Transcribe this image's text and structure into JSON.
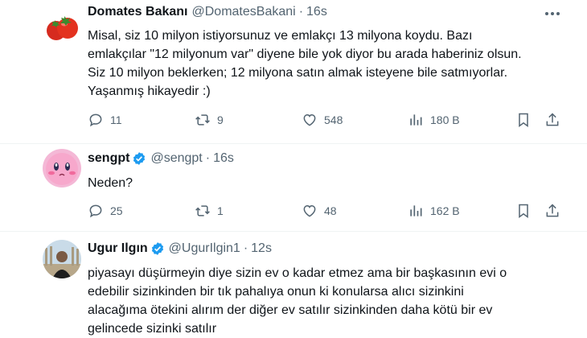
{
  "tweets": [
    {
      "name": "Domates Bakanı",
      "handle": "@DomatesBakani",
      "time": "16s",
      "verified": false,
      "text": [
        "Misal, siz 10 milyon istiyorsunuz ve emlakçı 13 milyona koydu. Bazı",
        "emlakçılar \"12 milyonum var\" diyene bile yok diyor bu arada haberiniz olsun.",
        "Siz 10 milyon beklerken; 12 milyona satın almak isteyene bile satmıyorlar.",
        "Yaşanmış hikayedir :)"
      ],
      "replies": "11",
      "retweets": "9",
      "likes": "548",
      "views": "180 B",
      "avatar_icon": "tomato-icon"
    },
    {
      "name": "sengpt",
      "handle": "@sengpt",
      "time": "16s",
      "verified": true,
      "text": [
        "Neden?"
      ],
      "replies": "25",
      "retweets": "1",
      "likes": "48",
      "views": "162 B",
      "avatar_icon": "pink-character-icon"
    },
    {
      "name": "Ugur Ilgın",
      "handle": "@UgurIlgin1",
      "time": "12s",
      "verified": true,
      "text": [
        "piyasayı düşürmeyin diye sizin ev o kadar etmez ama bir başkasının evi o",
        "edebilir sizinkinden bir tık pahalıya onun ki konularsa alıcı sizinkini",
        "alacağıma ötekini alırım der diğer ev satılır sizinkinden daha kötü bir ev",
        "gelincede sizinki satılır"
      ],
      "avatar_icon": "person-photo-icon"
    }
  ],
  "colors": {
    "text": "#0f1419",
    "secondary": "#536471",
    "verified": "#1d9bf0",
    "divider": "#eff3f4"
  }
}
